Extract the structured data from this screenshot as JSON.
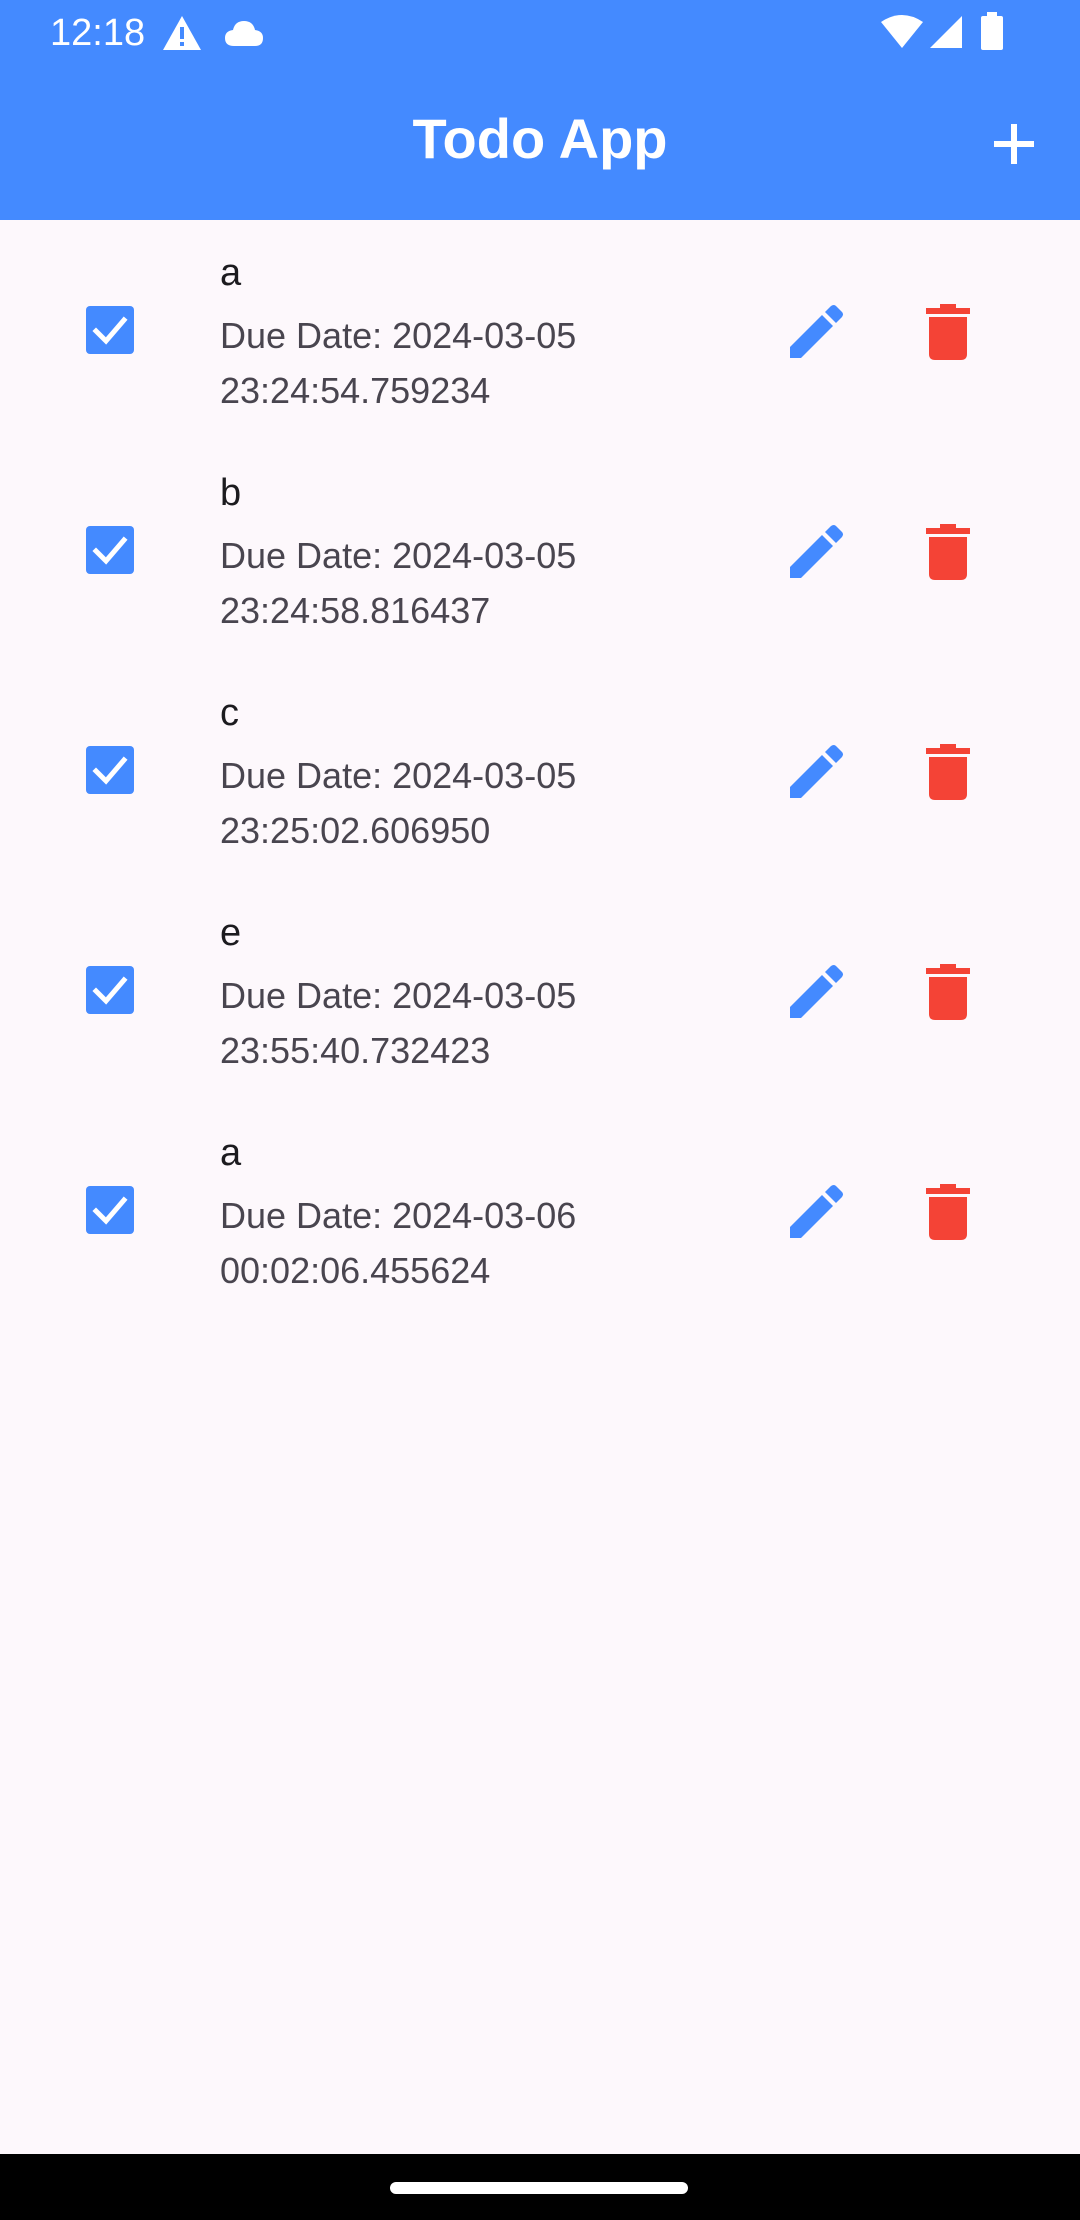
{
  "status_bar": {
    "time": "12:18",
    "icons": [
      "warning-icon",
      "cloud-icon",
      "wifi-icon",
      "signal-icon",
      "battery-icon"
    ]
  },
  "app_bar": {
    "title": "Todo App",
    "add_icon": "plus-icon"
  },
  "colors": {
    "primary": "#448aff",
    "delete": "#f44336",
    "background": "#fdf8fc"
  },
  "todos": [
    {
      "title": "a",
      "due_line1": "Due Date: 2024-03-05",
      "due_line2": "23:24:54.759234",
      "checked": true
    },
    {
      "title": "b",
      "due_line1": "Due Date: 2024-03-05",
      "due_line2": "23:24:58.816437",
      "checked": true
    },
    {
      "title": "c",
      "due_line1": "Due Date: 2024-03-05",
      "due_line2": "23:25:02.606950",
      "checked": true
    },
    {
      "title": "e",
      "due_line1": "Due Date: 2024-03-05",
      "due_line2": "23:55:40.732423",
      "checked": true
    },
    {
      "title": "a",
      "due_line1": "Due Date: 2024-03-06",
      "due_line2": "00:02:06.455624",
      "checked": true
    }
  ]
}
